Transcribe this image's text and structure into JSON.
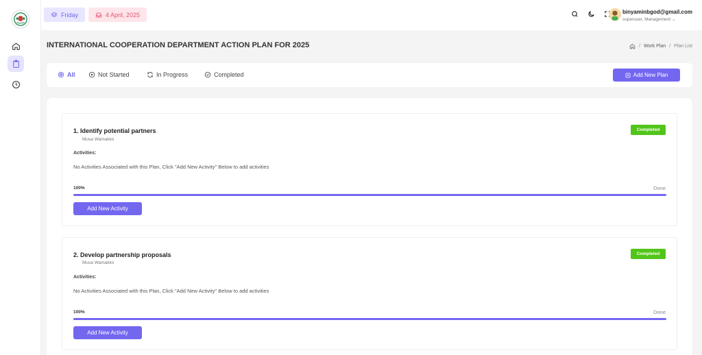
{
  "sidebar": {
    "items": [
      {
        "icon": "home-icon"
      },
      {
        "icon": "clipboard-icon",
        "active": true
      },
      {
        "icon": "clock-icon"
      }
    ]
  },
  "topbar": {
    "day": "Friday",
    "date": "4 April, 2025",
    "user_email": "binyaminbgod@gmail.com",
    "user_role": "superuser, Management ⌄"
  },
  "page": {
    "title": "INTERNATIONAL COOPERATION DEPARTMENT ACTION PLAN FOR 2025",
    "breadcrumb": [
      "Work Plan",
      "Plan List"
    ]
  },
  "filters": {
    "all": "All",
    "not_started": "Not Started",
    "in_progress": "In Progress",
    "completed": "Completed",
    "add_plan": "Add New Plan"
  },
  "plans": [
    {
      "title": "1. Identify potential partners",
      "owner": "Musa Wamakko",
      "status": "Completed",
      "activities_label": "Activities:",
      "empty_text": "No Activities Associated with this Plan, Click \"Add New Activity\" Below to add activities",
      "progress_text": "100%",
      "progress": 1.0,
      "progress_status": "Done",
      "add_activity": "Add New Activity"
    },
    {
      "title": "2. Develop partnership proposals",
      "owner": "Musa Wamakko",
      "status": "Completed",
      "activities_label": "Activities:",
      "empty_text": "No Activities Associated with this Plan, Click \"Add New Activity\" Below to add activities",
      "progress_text": "100%",
      "progress": 1.0,
      "progress_status": "Done",
      "add_activity": "Add New Activity"
    }
  ],
  "colors": {
    "accent": "#7367f0",
    "success": "#52c41a",
    "date_chip": "#e8536f"
  }
}
